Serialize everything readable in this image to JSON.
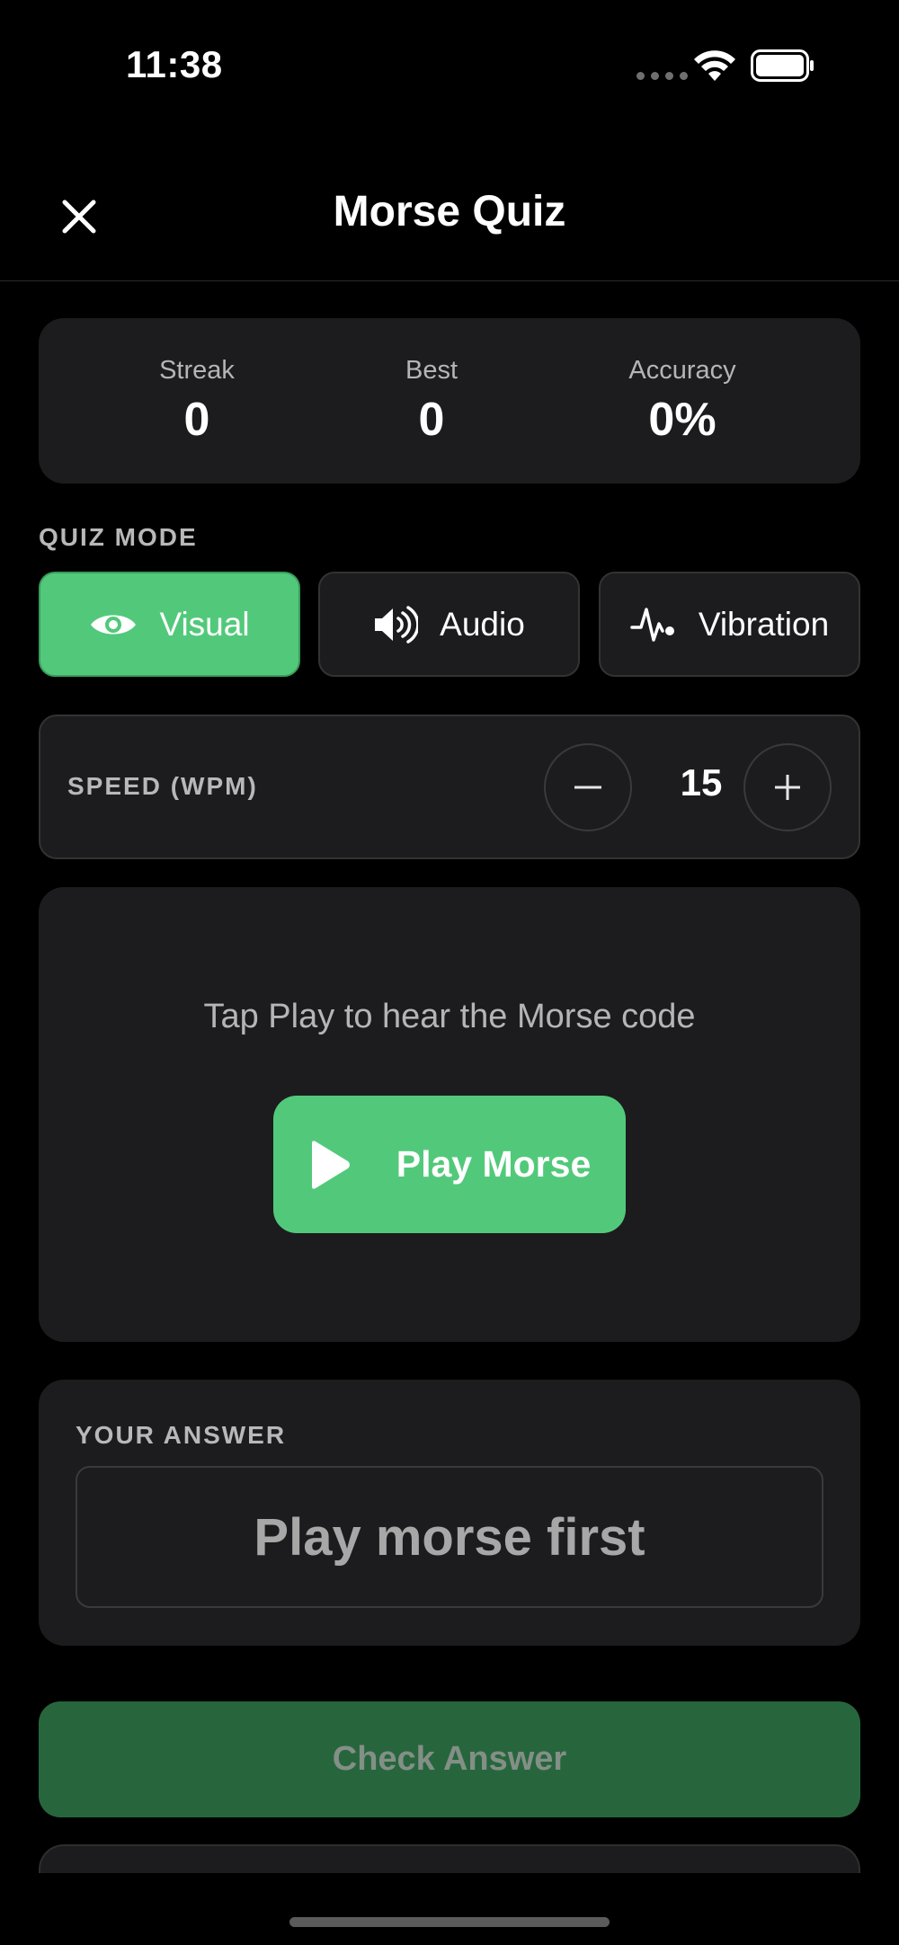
{
  "status_bar": {
    "time": "11:38"
  },
  "nav": {
    "title": "Morse Quiz",
    "close_icon": "close-icon"
  },
  "stats": [
    {
      "label": "Streak",
      "value": "0"
    },
    {
      "label": "Best",
      "value": "0"
    },
    {
      "label": "Accuracy",
      "value": "0%"
    }
  ],
  "quiz_mode": {
    "label": "QUIZ MODE",
    "modes": [
      {
        "label": "Visual",
        "icon": "eye-icon",
        "active": true
      },
      {
        "label": "Audio",
        "icon": "speaker-icon",
        "active": false
      },
      {
        "label": "Vibration",
        "icon": "waveform-icon",
        "active": false
      }
    ]
  },
  "speed": {
    "label": "SPEED (WPM)",
    "value": "15",
    "decrement_icon": "minus-icon",
    "increment_icon": "plus-icon"
  },
  "play": {
    "prompt": "Tap Play to hear the Morse code",
    "button_label": "Play Morse",
    "icon": "play-icon"
  },
  "answer": {
    "label": "YOUR ANSWER",
    "placeholder": "Play morse first"
  },
  "check": {
    "label": "Check Answer"
  },
  "colors": {
    "accent": "#52c97a",
    "accent_disabled": "#27663d",
    "card": "#1c1c1e",
    "background": "#000000"
  }
}
